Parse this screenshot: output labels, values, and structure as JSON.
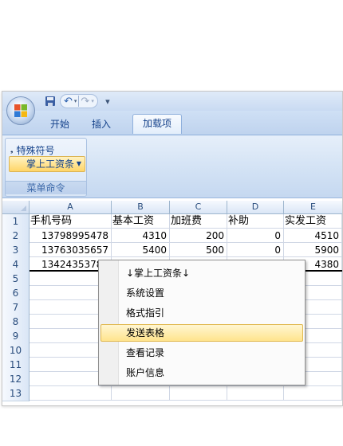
{
  "qat": {
    "undo": "↶",
    "redo": "↷",
    "customize": "▾"
  },
  "tabs": [
    {
      "label": "开始"
    },
    {
      "label": "插入"
    },
    {
      "label": "加载项"
    }
  ],
  "ribbon": {
    "special_symbol": "特殊符号",
    "dropdown": "掌上工资条",
    "group_label": "菜单命令"
  },
  "sheet": {
    "columns": [
      "A",
      "B",
      "C",
      "D",
      "E"
    ],
    "rows": [
      "1",
      "2",
      "3",
      "4",
      "5",
      "6",
      "7",
      "8",
      "9",
      "10",
      "11",
      "12",
      "13"
    ],
    "header": [
      "手机号码",
      "基本工资",
      "加班费",
      "补助",
      "实发工资"
    ],
    "data": [
      [
        "13798995478",
        "4310",
        "200",
        "0",
        "4510"
      ],
      [
        "13763035657",
        "5400",
        "500",
        "0",
        "5900"
      ],
      [
        "13424353781",
        "",
        "",
        "",
        "4380"
      ]
    ]
  },
  "context_menu": {
    "items": [
      "↓掌上工资条↓",
      "系统设置",
      "格式指引",
      "发送表格",
      "查看记录",
      "账户信息"
    ],
    "highlighted": "发送表格"
  }
}
